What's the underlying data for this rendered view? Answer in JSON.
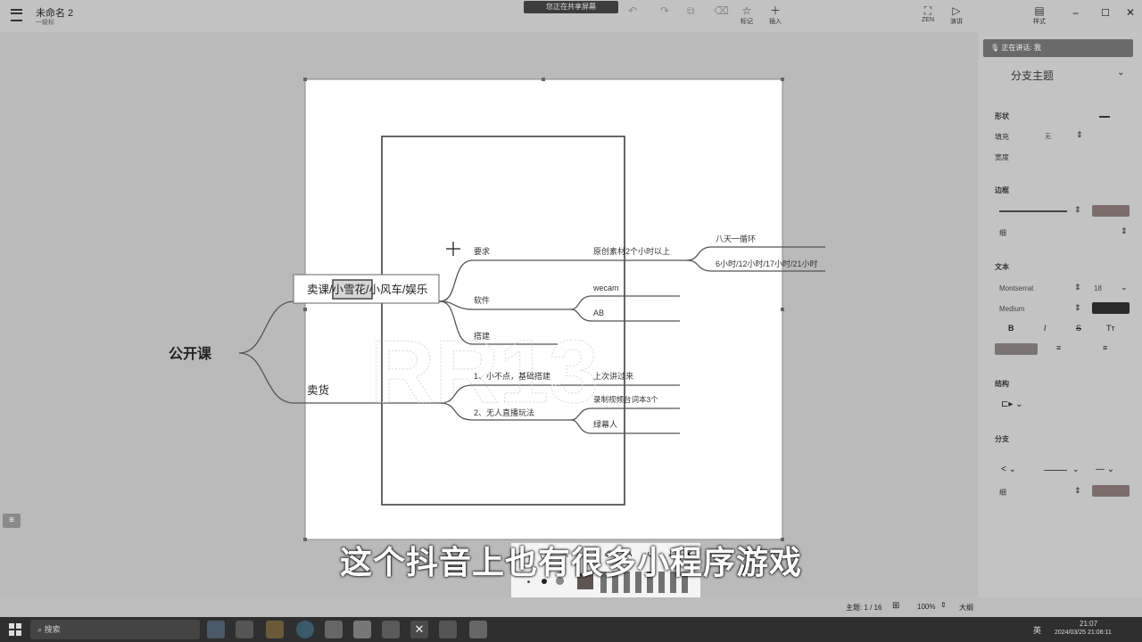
{
  "app": {
    "doc_title": "未命名 2",
    "doc_subtitle": "一级标",
    "screen_share_banner": "您正在共享屏幕"
  },
  "toolbar": {
    "mark_label": "标记",
    "insert_label": "插入",
    "zen_label": "ZEN",
    "present_label": "演讲",
    "style_label": "样式"
  },
  "speaking_badge": "正在讲话: 我",
  "sidebar": {
    "topic_type": "分支主题",
    "shape_section": "形状",
    "fill_label": "填充",
    "fill_value": "无",
    "width_label": "宽度",
    "border_section": "边框",
    "border_thickness": "细",
    "text_section": "文本",
    "font_name": "Montserrat",
    "font_size": "18",
    "font_weight": "Medium",
    "structure_section": "结构",
    "branch_section": "分支",
    "branch_thickness": "细",
    "colors": {
      "border_swatch": "#7a6d6a",
      "text_swatch": "#2a2a2a",
      "highlight_swatch": "#7a7573",
      "branch_swatch": "#7a6d6a"
    }
  },
  "mindmap": {
    "root": "公开课",
    "branch1": "卖课/小雪花/小风车/娱乐",
    "branch1_highlight": "小雪花",
    "branch2": "卖货",
    "req": "要求",
    "req_child": "原创素材2个小时以上",
    "req_grand1": "八天一循环",
    "req_grand2": "6小时/12小时/17小时/21小时",
    "software": "软件",
    "soft1": "wecam",
    "soft2": "AB",
    "build": "搭建",
    "item1": "1、小不点，基础搭建",
    "item1_child": "上次讲过来",
    "item2": "2、无人直播玩法",
    "item2_child1": "录制视频台词本3个",
    "item2_child2": "绿幕人"
  },
  "subtitle": "这个抖音上也有很多小程序游戏",
  "status": {
    "topics": "主题: 1 / 16",
    "zoom": "100%",
    "fit": "大纲"
  },
  "taskbar": {
    "search": "搜索",
    "ime": "英",
    "time": "21:07",
    "date": "2024/03/25 21:08:11"
  }
}
